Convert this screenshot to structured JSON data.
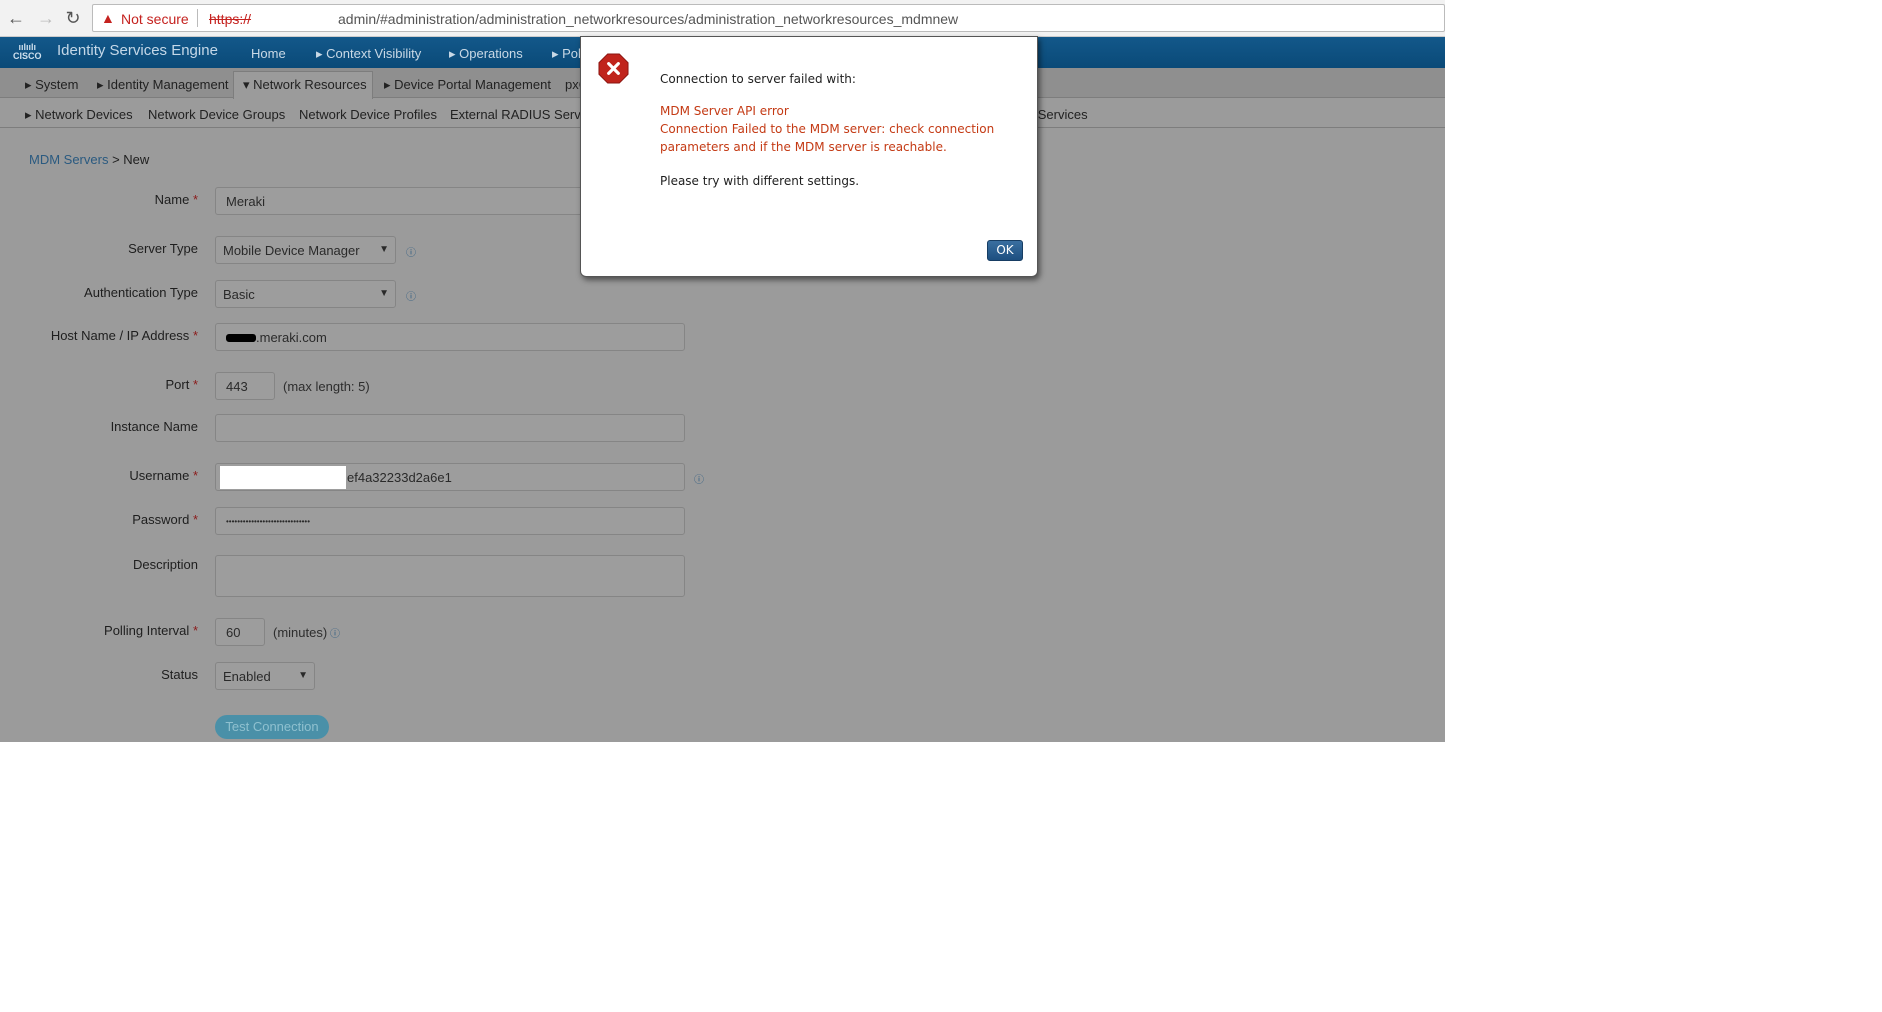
{
  "browser": {
    "security_label": "Not secure",
    "scheme": "https://",
    "url": "admin/#administration/administration_networkresources/administration_networkresources_mdmnew"
  },
  "header": {
    "logo": "cisco",
    "title": "Identity Services Engine",
    "nav": [
      "Home",
      "▸ Context Visibility",
      "▸ Operations",
      "▸ Policy"
    ]
  },
  "tabs": [
    "▸ System",
    "▸ Identity Management",
    "▾ Network Resources",
    "▸ Device Portal Management",
    "pxGrid Services"
  ],
  "subnav": [
    "▸ Network Devices",
    "Network Device Groups",
    "Network Device Profiles",
    "External RADIUS Servers",
    "Location Services"
  ],
  "breadcrumb": {
    "parent": "MDM Servers",
    "sep": " > ",
    "current": "New"
  },
  "form": {
    "name": {
      "label": "Name",
      "value": "Meraki"
    },
    "server_type": {
      "label": "Server Type",
      "value": "Mobile Device Manager"
    },
    "auth_type": {
      "label": "Authentication Type",
      "value": "Basic"
    },
    "host": {
      "label": "Host Name / IP Address",
      "value": ".meraki.com"
    },
    "port": {
      "label": "Port",
      "value": "443",
      "hint": "(max length: 5)"
    },
    "instance": {
      "label": "Instance Name",
      "value": ""
    },
    "username": {
      "label": "Username",
      "value": "ef4a32233d2a6e1"
    },
    "password": {
      "label": "Password",
      "value": "••••••••••••••••••••••••••••••"
    },
    "description": {
      "label": "Description",
      "value": ""
    },
    "polling": {
      "label": "Polling Interval",
      "value": "60",
      "hint": "(minutes)"
    },
    "status": {
      "label": "Status",
      "value": "Enabled"
    },
    "required_mark": "*",
    "test_button": "Test Connection"
  },
  "dialog": {
    "title": "Connection to server failed with:",
    "error1": "MDM Server API error",
    "error2": "Connection Failed to the MDM server: check connection",
    "error3": "parameters and if the MDM server is reachable.",
    "advice": "Please try with different settings.",
    "ok": "OK",
    "icon": "error-x-icon"
  },
  "colors": {
    "header": "#0a4a78",
    "error_text": "#c43a14",
    "ok_button": "#1d4f80"
  }
}
